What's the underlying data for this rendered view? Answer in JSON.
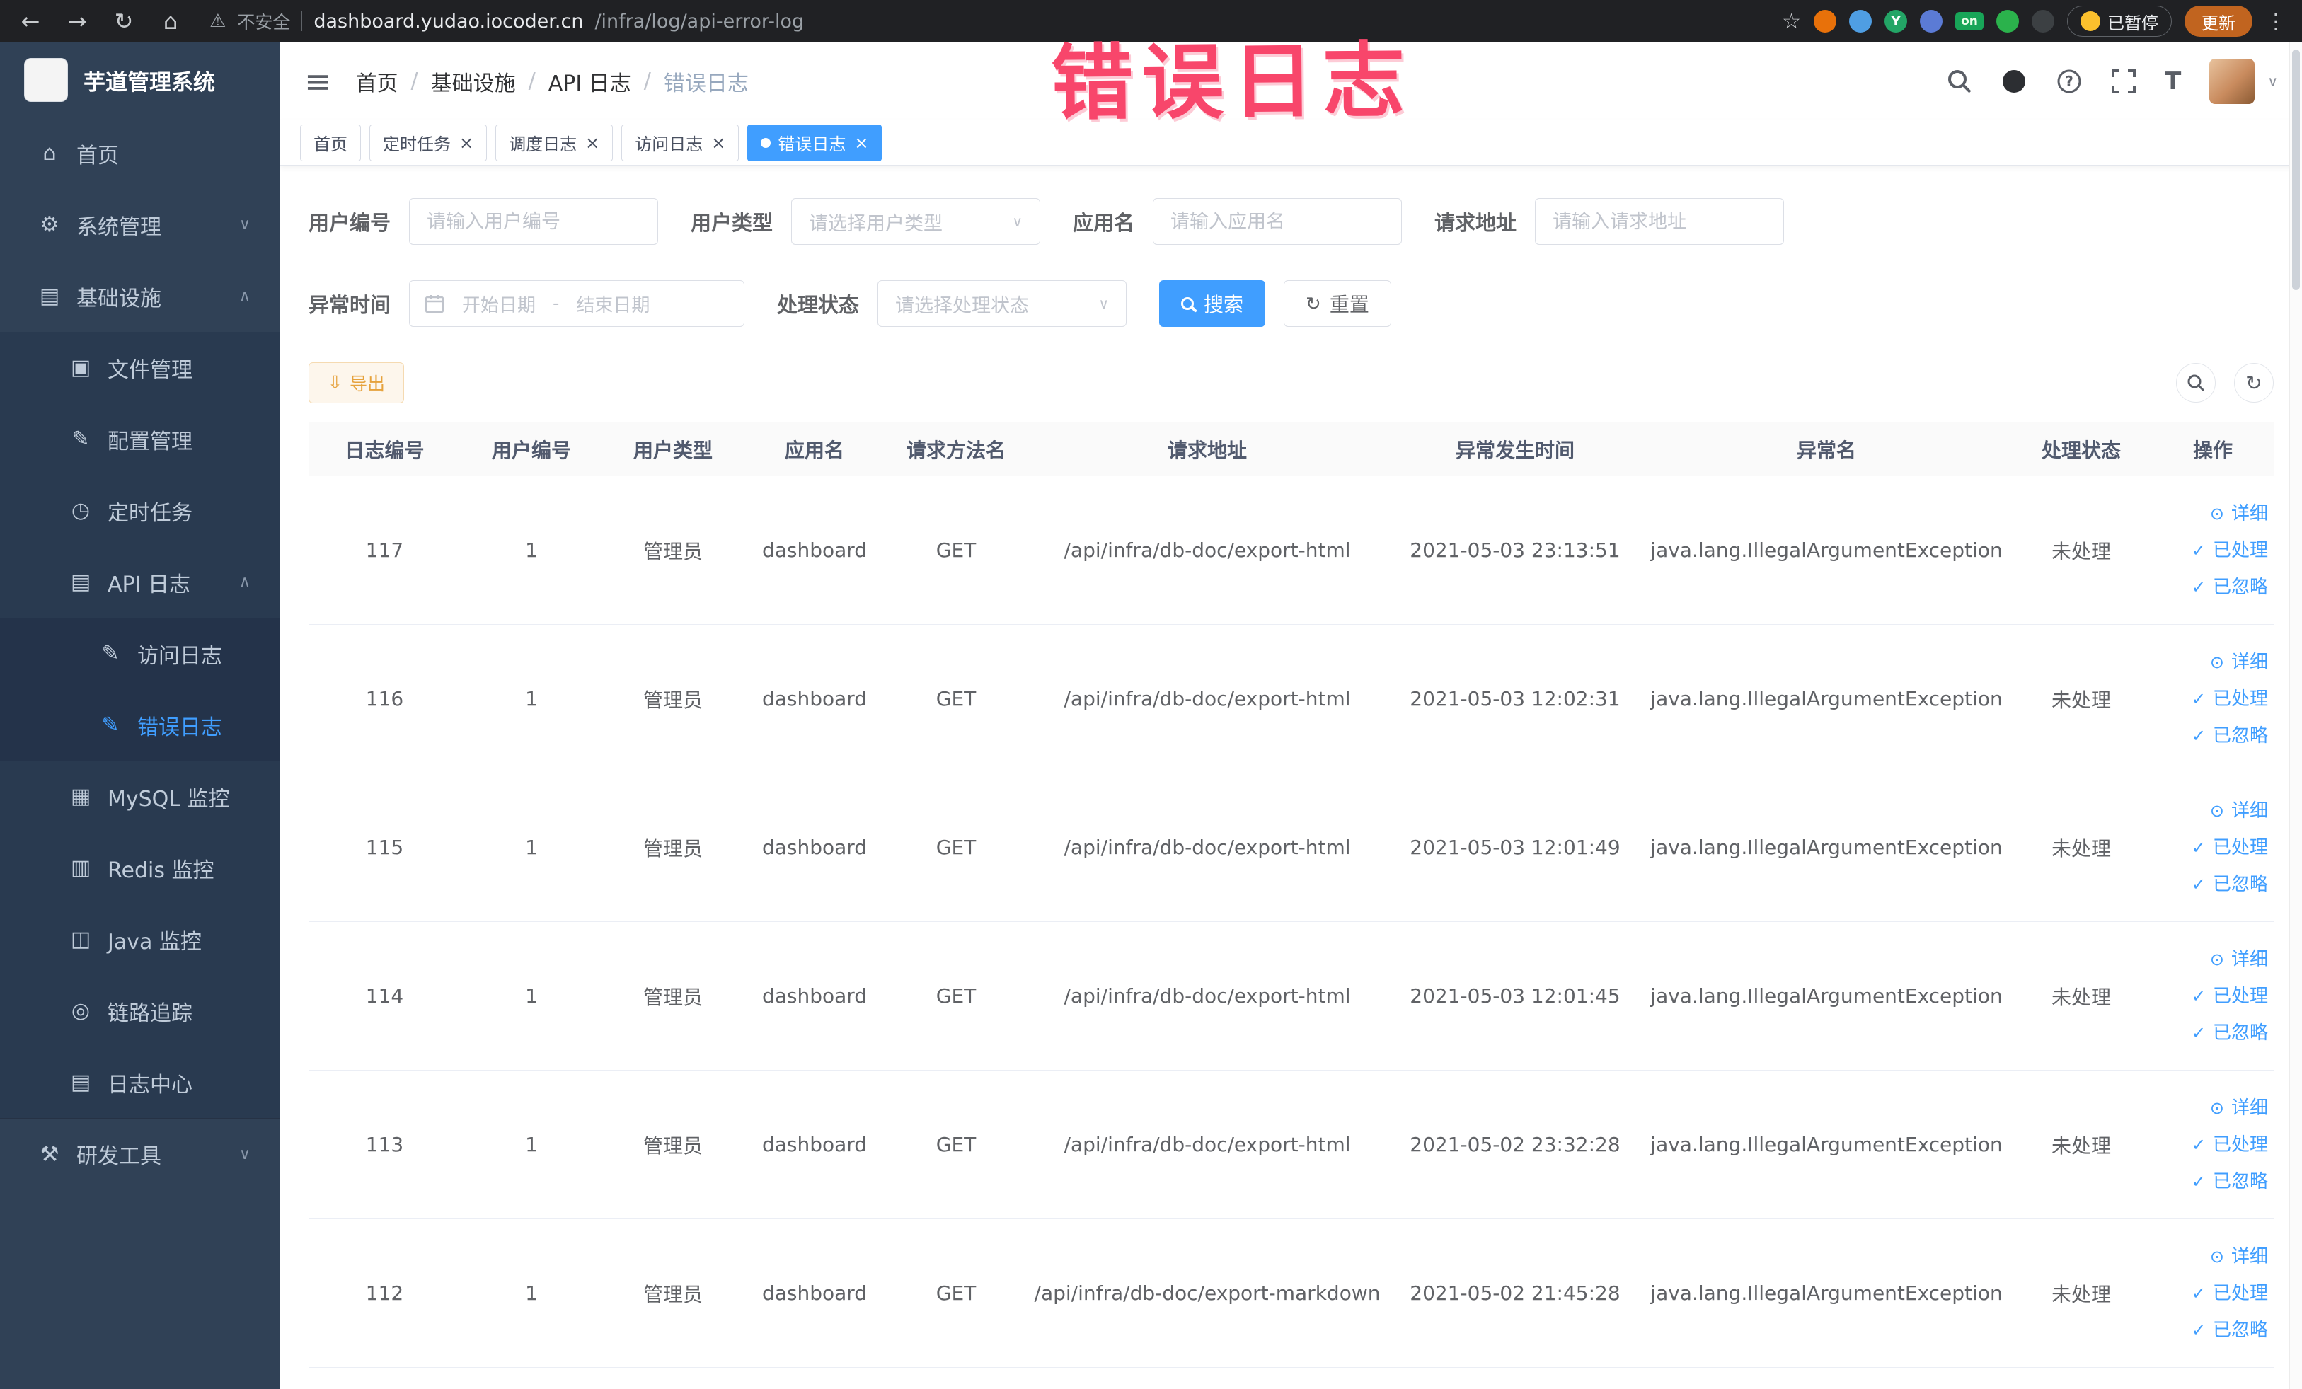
{
  "browser": {
    "security_label": "不安全",
    "url_host": "dashboard.yudao.iocoder.cn",
    "url_path": "/infra/log/api-error-log",
    "ext_y_label": "Y",
    "ext_on_label": "on",
    "paused_label": "已暂停",
    "update_label": "更新"
  },
  "annotation": "错误日志",
  "sidebar": {
    "title": "芋道管理系统",
    "menu": [
      {
        "name": "home",
        "label": "首页",
        "icon": "dashboard-icon",
        "level": 1
      },
      {
        "name": "system-management",
        "label": "系统管理",
        "icon": "gear-icon",
        "level": 1,
        "chevron": "down"
      },
      {
        "name": "infrastructure",
        "label": "基础设施",
        "icon": "grid-icon",
        "level": 1,
        "chevron": "up"
      },
      {
        "name": "file-management",
        "label": "文件管理",
        "icon": "folder-icon",
        "level": 2
      },
      {
        "name": "config-management",
        "label": "配置管理",
        "icon": "edit-icon",
        "level": 2
      },
      {
        "name": "scheduled-tasks",
        "label": "定时任务",
        "icon": "clock-icon",
        "level": 2
      },
      {
        "name": "api-logs",
        "label": "API 日志",
        "icon": "doc-icon",
        "level": 2,
        "chevron": "up"
      },
      {
        "name": "access-log",
        "label": "访问日志",
        "icon": "edit-icon",
        "level": 3
      },
      {
        "name": "error-log",
        "label": "错误日志",
        "icon": "edit-icon",
        "level": 3,
        "active": true
      },
      {
        "name": "mysql-monitor",
        "label": "MySQL 监控",
        "icon": "monitor-icon",
        "level": 2
      },
      {
        "name": "redis-monitor",
        "label": "Redis 监控",
        "icon": "db-icon",
        "level": 2
      },
      {
        "name": "java-monitor",
        "label": "Java 监控",
        "icon": "java-icon",
        "level": 2
      },
      {
        "name": "link-tracing",
        "label": "链路追踪",
        "icon": "eye-icon",
        "level": 2
      },
      {
        "name": "log-center",
        "label": "日志中心",
        "icon": "doc-icon",
        "level": 2
      },
      {
        "name": "dev-tools",
        "label": "研发工具",
        "icon": "tools-icon",
        "level": 1,
        "chevron": "down",
        "divider": true
      }
    ]
  },
  "header": {
    "breadcrumbs": [
      "首页",
      "基础设施",
      "API 日志",
      "错误日志"
    ]
  },
  "tags": [
    {
      "label": "首页",
      "closable": false,
      "active": false
    },
    {
      "label": "定时任务",
      "closable": true,
      "active": false
    },
    {
      "label": "调度日志",
      "closable": true,
      "active": false
    },
    {
      "label": "访问日志",
      "closable": true,
      "active": false
    },
    {
      "label": "错误日志",
      "closable": true,
      "active": true
    }
  ],
  "filters": {
    "user_id": {
      "label": "用户编号",
      "placeholder": "请输入用户编号"
    },
    "user_type": {
      "label": "用户类型",
      "placeholder": "请选择用户类型"
    },
    "app_name": {
      "label": "应用名",
      "placeholder": "请输入应用名"
    },
    "request_url": {
      "label": "请求地址",
      "placeholder": "请输入请求地址"
    },
    "exception_time": {
      "label": "异常时间",
      "start_placeholder": "开始日期",
      "separator": "-",
      "end_placeholder": "结束日期"
    },
    "process_status": {
      "label": "处理状态",
      "placeholder": "请选择处理状态"
    },
    "search_button": "搜索",
    "reset_button": "重置"
  },
  "toolbar": {
    "export_button": "导出"
  },
  "table": {
    "columns": [
      "日志编号",
      "用户编号",
      "用户类型",
      "应用名",
      "请求方法名",
      "请求地址",
      "异常发生时间",
      "异常名",
      "处理状态",
      "操作"
    ],
    "actions": [
      "详细",
      "已处理",
      "已忽略"
    ],
    "rows": [
      {
        "id": "117",
        "user_id": "1",
        "user_type": "管理员",
        "app": "dashboard",
        "method": "GET",
        "url": "/api/infra/db-doc/export-html",
        "time": "2021-05-03 23:13:51",
        "exception": "java.lang.IllegalArgumentException",
        "status": "未处理"
      },
      {
        "id": "116",
        "user_id": "1",
        "user_type": "管理员",
        "app": "dashboard",
        "method": "GET",
        "url": "/api/infra/db-doc/export-html",
        "time": "2021-05-03 12:02:31",
        "exception": "java.lang.IllegalArgumentException",
        "status": "未处理"
      },
      {
        "id": "115",
        "user_id": "1",
        "user_type": "管理员",
        "app": "dashboard",
        "method": "GET",
        "url": "/api/infra/db-doc/export-html",
        "time": "2021-05-03 12:01:49",
        "exception": "java.lang.IllegalArgumentException",
        "status": "未处理"
      },
      {
        "id": "114",
        "user_id": "1",
        "user_type": "管理员",
        "app": "dashboard",
        "method": "GET",
        "url": "/api/infra/db-doc/export-html",
        "time": "2021-05-03 12:01:45",
        "exception": "java.lang.IllegalArgumentException",
        "status": "未处理"
      },
      {
        "id": "113",
        "user_id": "1",
        "user_type": "管理员",
        "app": "dashboard",
        "method": "GET",
        "url": "/api/infra/db-doc/export-html",
        "time": "2021-05-02 23:32:28",
        "exception": "java.lang.IllegalArgumentException",
        "status": "未处理"
      },
      {
        "id": "112",
        "user_id": "1",
        "user_type": "管理员",
        "app": "dashboard",
        "method": "GET",
        "url": "/api/infra/db-doc/export-markdown",
        "time": "2021-05-02 21:45:28",
        "exception": "java.lang.IllegalArgumentException",
        "status": "未处理"
      }
    ]
  }
}
